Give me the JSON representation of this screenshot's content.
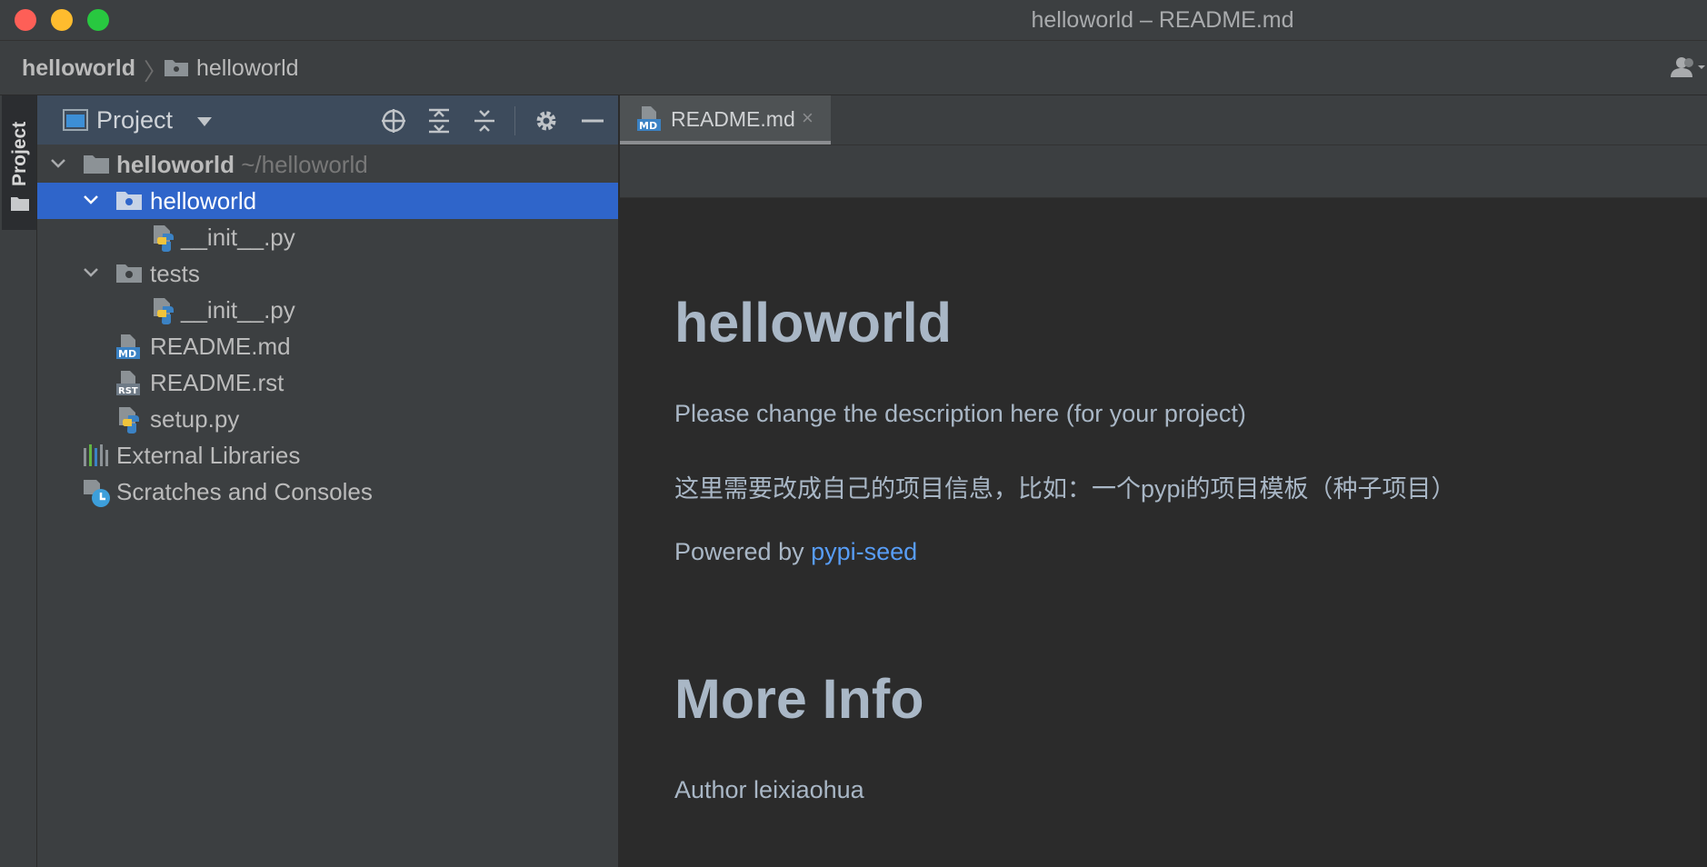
{
  "window": {
    "title": "helloworld – README.md"
  },
  "breadcrumb": {
    "root": "helloworld",
    "child": "helloworld"
  },
  "sidebar": {
    "tab_label": "Project"
  },
  "project_panel": {
    "title": "Project",
    "tree": [
      {
        "label": "helloworld",
        "hint": "~/helloworld"
      },
      {
        "label": "helloworld"
      },
      {
        "label": "__init__.py"
      },
      {
        "label": "tests"
      },
      {
        "label": "__init__.py"
      },
      {
        "label": "README.md"
      },
      {
        "label": "README.rst"
      },
      {
        "label": "setup.py"
      },
      {
        "label": "External Libraries"
      },
      {
        "label": "Scratches and Consoles"
      }
    ]
  },
  "editor": {
    "tab_label": "README.md",
    "tab_close": "×"
  },
  "preview": {
    "heading1": "helloworld",
    "description": "Please change the description here (for your project)",
    "description_cn": "这里需要改成自己的项目信息，比如：一个pypi的项目模板（种子项目）",
    "powered_prefix": "Powered by",
    "powered_link": "pypi-seed",
    "heading2": "More Info",
    "author_line": "Author leixiaohua"
  },
  "colors": {
    "selection": "#2f65ca",
    "panel_header": "#3d4b5c",
    "link": "#589df6",
    "heading": "#a9b7c6"
  }
}
